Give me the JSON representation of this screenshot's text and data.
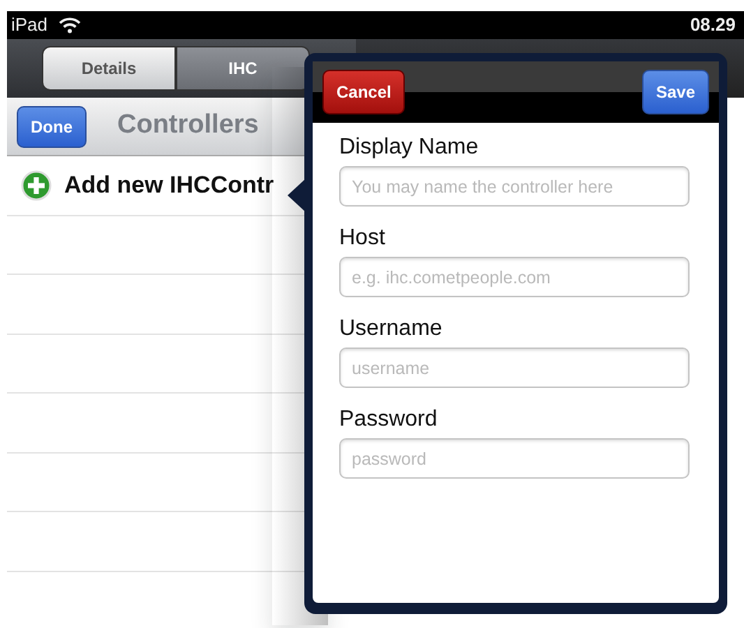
{
  "status_bar": {
    "device": "iPad",
    "time": "08.29"
  },
  "segments": [
    {
      "label": "Details",
      "selected": false
    },
    {
      "label": "IHC",
      "selected": true
    }
  ],
  "master": {
    "done_button": "Done",
    "title": "Controllers",
    "add_row": "Add new IHCContr"
  },
  "popover": {
    "cancel_button": "Cancel",
    "save_button": "Save",
    "fields": [
      {
        "label": "Display Name",
        "placeholder": "You may name the controller here"
      },
      {
        "label": "Host",
        "placeholder": "e.g. ihc.cometpeople.com"
      },
      {
        "label": "Username",
        "placeholder": "username"
      },
      {
        "label": "Password",
        "placeholder": "password"
      }
    ]
  }
}
